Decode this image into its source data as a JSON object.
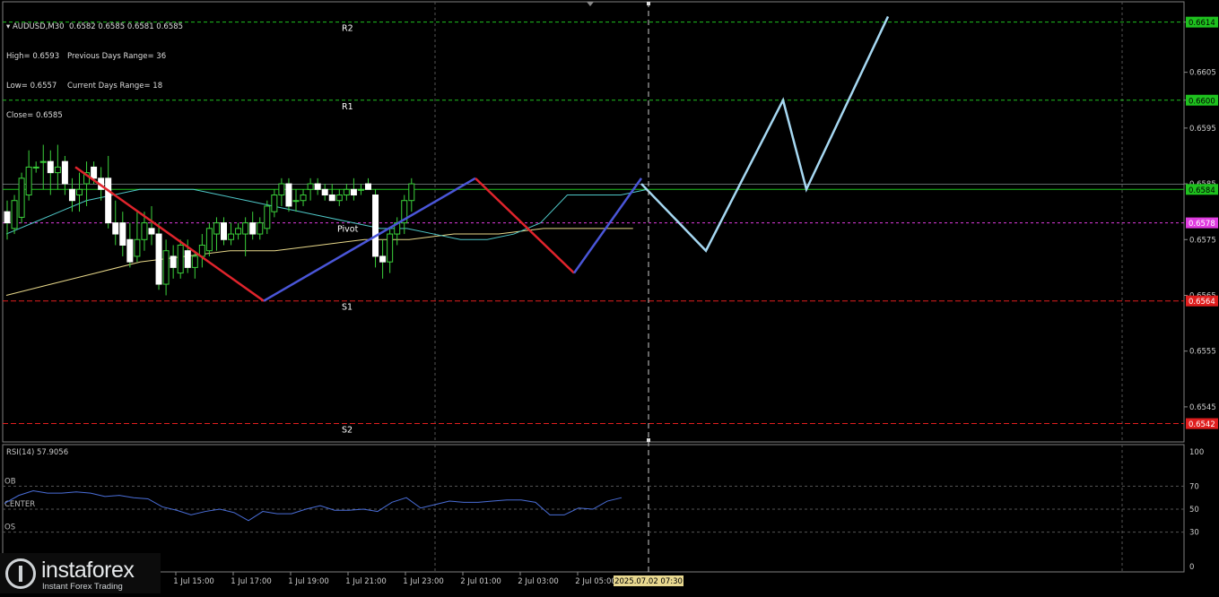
{
  "header": {
    "symbol_line": "AUDUSD,M30  0.6582 0.6585 0.6581 0.6585",
    "high": "High= 0.6593",
    "prev_range": "Previous Days Range= 36",
    "low": "Low= 0.6557",
    "curr_range": "Current Days Range= 18",
    "close": "Close= 0.6585"
  },
  "levels": {
    "r2": {
      "label": "R2",
      "value": 0.6614,
      "text": "0.6614",
      "color": "#1ec11e"
    },
    "r1": {
      "label": "R1",
      "value": 0.66,
      "text": "0.6600",
      "color": "#1ec11e"
    },
    "current": {
      "value": 0.6584,
      "text": "0.6584",
      "color": "#1ec11e"
    },
    "pivot": {
      "label": "Pivot",
      "value": 0.6578,
      "text": "0.6578",
      "color": "#e03ce0"
    },
    "s1": {
      "label": "S1",
      "value": 0.6564,
      "text": "0.6564",
      "color": "#e01e1e"
    },
    "s2": {
      "label": "S2",
      "value": 0.6542,
      "text": "0.6542",
      "color": "#e01e1e"
    }
  },
  "price_ticks": [
    "0.6614",
    "0.6605",
    "0.6600",
    "0.6595",
    "0.6585",
    "0.6575",
    "0.6565",
    "0.6555",
    "0.6545"
  ],
  "time_ticks": [
    "1 Jul 15:00",
    "1 Jul 17:00",
    "1 Jul 19:00",
    "1 Jul 21:00",
    "1 Jul 23:00",
    "2 Jul 01:00",
    "2 Jul 03:00",
    "2 Jul 05:00"
  ],
  "cursor_time": "2025.07.02 07:30",
  "rsi": {
    "label": "RSI(14) 57.9056",
    "ticks": [
      "100",
      "70",
      "50",
      "30",
      "0"
    ],
    "ob": "OB",
    "center": "CENTER",
    "os": "OS",
    "color": "#4a6ed8"
  },
  "branding": {
    "name": "instaforex",
    "tagline": "Instant Forex Trading"
  },
  "chart_data": {
    "type": "candlestick",
    "symbol": "AUDUSD",
    "timeframe": "M30",
    "ylim": [
      0.654,
      0.6618
    ],
    "candles": [
      {
        "o": 0.658,
        "h": 0.6582,
        "l": 0.6575,
        "c": 0.6578
      },
      {
        "o": 0.6577,
        "h": 0.6583,
        "l": 0.6576,
        "c": 0.6582
      },
      {
        "o": 0.6579,
        "h": 0.6587,
        "l": 0.6578,
        "c": 0.6586
      },
      {
        "o": 0.6583,
        "h": 0.6591,
        "l": 0.6582,
        "c": 0.6588
      },
      {
        "o": 0.6588,
        "h": 0.6589,
        "l": 0.6587,
        "c": 0.6588
      },
      {
        "o": 0.6589,
        "h": 0.6592,
        "l": 0.6584,
        "c": 0.6589
      },
      {
        "o": 0.6589,
        "h": 0.6591,
        "l": 0.6583,
        "c": 0.6587
      },
      {
        "o": 0.6587,
        "h": 0.6592,
        "l": 0.6584,
        "c": 0.6588
      },
      {
        "o": 0.6589,
        "h": 0.659,
        "l": 0.6583,
        "c": 0.6585
      },
      {
        "o": 0.6584,
        "h": 0.6586,
        "l": 0.658,
        "c": 0.6582
      },
      {
        "o": 0.6583,
        "h": 0.6587,
        "l": 0.658,
        "c": 0.6584
      },
      {
        "o": 0.6585,
        "h": 0.6589,
        "l": 0.6581,
        "c": 0.6587
      },
      {
        "o": 0.6588,
        "h": 0.6589,
        "l": 0.6585,
        "c": 0.6586
      },
      {
        "o": 0.6586,
        "h": 0.6588,
        "l": 0.6582,
        "c": 0.6584
      },
      {
        "o": 0.6586,
        "h": 0.659,
        "l": 0.6577,
        "c": 0.6578
      },
      {
        "o": 0.6578,
        "h": 0.6582,
        "l": 0.6574,
        "c": 0.6576
      },
      {
        "o": 0.6578,
        "h": 0.658,
        "l": 0.6572,
        "c": 0.6574
      },
      {
        "o": 0.6575,
        "h": 0.6578,
        "l": 0.657,
        "c": 0.6571
      },
      {
        "o": 0.6572,
        "h": 0.658,
        "l": 0.6571,
        "c": 0.6575
      },
      {
        "o": 0.6575,
        "h": 0.658,
        "l": 0.6573,
        "c": 0.6578
      },
      {
        "o": 0.6577,
        "h": 0.6581,
        "l": 0.6574,
        "c": 0.6576
      },
      {
        "o": 0.6576,
        "h": 0.6578,
        "l": 0.6566,
        "c": 0.6567
      },
      {
        "o": 0.6567,
        "h": 0.6575,
        "l": 0.6565,
        "c": 0.6573
      },
      {
        "o": 0.6572,
        "h": 0.6574,
        "l": 0.6568,
        "c": 0.657
      },
      {
        "o": 0.6569,
        "h": 0.6575,
        "l": 0.6568,
        "c": 0.6574
      },
      {
        "o": 0.6573,
        "h": 0.6575,
        "l": 0.6569,
        "c": 0.657
      },
      {
        "o": 0.657,
        "h": 0.6573,
        "l": 0.6568,
        "c": 0.6572
      },
      {
        "o": 0.6572,
        "h": 0.6576,
        "l": 0.657,
        "c": 0.6574
      },
      {
        "o": 0.6573,
        "h": 0.6578,
        "l": 0.6572,
        "c": 0.6577
      },
      {
        "o": 0.6576,
        "h": 0.6579,
        "l": 0.6573,
        "c": 0.6578
      },
      {
        "o": 0.6578,
        "h": 0.6579,
        "l": 0.6574,
        "c": 0.6575
      },
      {
        "o": 0.6575,
        "h": 0.6578,
        "l": 0.6574,
        "c": 0.6576
      },
      {
        "o": 0.6576,
        "h": 0.6578,
        "l": 0.6575,
        "c": 0.6577
      },
      {
        "o": 0.6576,
        "h": 0.6579,
        "l": 0.6572,
        "c": 0.6578
      },
      {
        "o": 0.6578,
        "h": 0.658,
        "l": 0.6575,
        "c": 0.6576
      },
      {
        "o": 0.6576,
        "h": 0.6579,
        "l": 0.6575,
        "c": 0.6578
      },
      {
        "o": 0.6577,
        "h": 0.6582,
        "l": 0.6576,
        "c": 0.6581
      },
      {
        "o": 0.658,
        "h": 0.6584,
        "l": 0.6579,
        "c": 0.6583
      },
      {
        "o": 0.6583,
        "h": 0.6586,
        "l": 0.6581,
        "c": 0.6585
      },
      {
        "o": 0.6585,
        "h": 0.6586,
        "l": 0.658,
        "c": 0.6581
      },
      {
        "o": 0.6582,
        "h": 0.6584,
        "l": 0.658,
        "c": 0.6582
      },
      {
        "o": 0.6582,
        "h": 0.6584,
        "l": 0.6581,
        "c": 0.6583
      },
      {
        "o": 0.6584,
        "h": 0.6586,
        "l": 0.6582,
        "c": 0.6585
      },
      {
        "o": 0.6585,
        "h": 0.6586,
        "l": 0.6583,
        "c": 0.6584
      },
      {
        "o": 0.6584,
        "h": 0.6585,
        "l": 0.6582,
        "c": 0.6583
      },
      {
        "o": 0.6583,
        "h": 0.6585,
        "l": 0.6582,
        "c": 0.6582
      },
      {
        "o": 0.6582,
        "h": 0.6584,
        "l": 0.6581,
        "c": 0.6583
      },
      {
        "o": 0.6583,
        "h": 0.6585,
        "l": 0.6582,
        "c": 0.6584
      },
      {
        "o": 0.6584,
        "h": 0.6586,
        "l": 0.6582,
        "c": 0.6583
      },
      {
        "o": 0.6584,
        "h": 0.6585,
        "l": 0.6583,
        "c": 0.6584
      },
      {
        "o": 0.6585,
        "h": 0.6586,
        "l": 0.6584,
        "c": 0.6584
      },
      {
        "o": 0.6583,
        "h": 0.6584,
        "l": 0.657,
        "c": 0.6572
      },
      {
        "o": 0.6572,
        "h": 0.6575,
        "l": 0.6568,
        "c": 0.6571
      },
      {
        "o": 0.6571,
        "h": 0.6577,
        "l": 0.6569,
        "c": 0.6576
      },
      {
        "o": 0.6576,
        "h": 0.6579,
        "l": 0.6574,
        "c": 0.6578
      },
      {
        "o": 0.6578,
        "h": 0.6583,
        "l": 0.6576,
        "c": 0.6582
      },
      {
        "o": 0.6582,
        "h": 0.6586,
        "l": 0.658,
        "c": 0.6585
      }
    ],
    "ma_fast": [
      0.6576,
      0.6578,
      0.658,
      0.6582,
      0.6583,
      0.6584,
      0.6584,
      0.6584,
      0.6583,
      0.6582,
      0.6581,
      0.658,
      0.6579,
      0.6578,
      0.6577,
      0.6577,
      0.6576,
      0.6575,
      0.6575,
      0.6576,
      0.6578,
      0.6583,
      0.6583,
      0.6583,
      0.6584
    ],
    "ma_slow": [
      0.6565,
      0.6567,
      0.6569,
      0.6571,
      0.6572,
      0.6573,
      0.6573,
      0.6574,
      0.6575,
      0.6575,
      0.6576,
      0.6576,
      0.6577,
      0.6577,
      0.6577
    ],
    "zigzag_red": [
      [
        {
          "x": 0.6588
        },
        {
          "x": 0.6564
        }
      ],
      [
        {
          "x": 0.6586
        },
        {
          "x": 0.6569
        }
      ]
    ],
    "zigzag_blue": [
      [
        0.6564,
        0.6586
      ],
      [
        0.6569,
        0.6586
      ]
    ],
    "forecast": [
      0.6585,
      0.6573,
      0.66,
      0.6584,
      0.6615
    ],
    "rsi_values": [
      55,
      62,
      66,
      64,
      64,
      65,
      64,
      61,
      62,
      60,
      59,
      52,
      49,
      45,
      48,
      50,
      47,
      40,
      48,
      46,
      46,
      50,
      53,
      49,
      49,
      50,
      48,
      56,
      60,
      51,
      54,
      57,
      56,
      56,
      57,
      58,
      58,
      56,
      45,
      45,
      51,
      50,
      57,
      60
    ]
  }
}
